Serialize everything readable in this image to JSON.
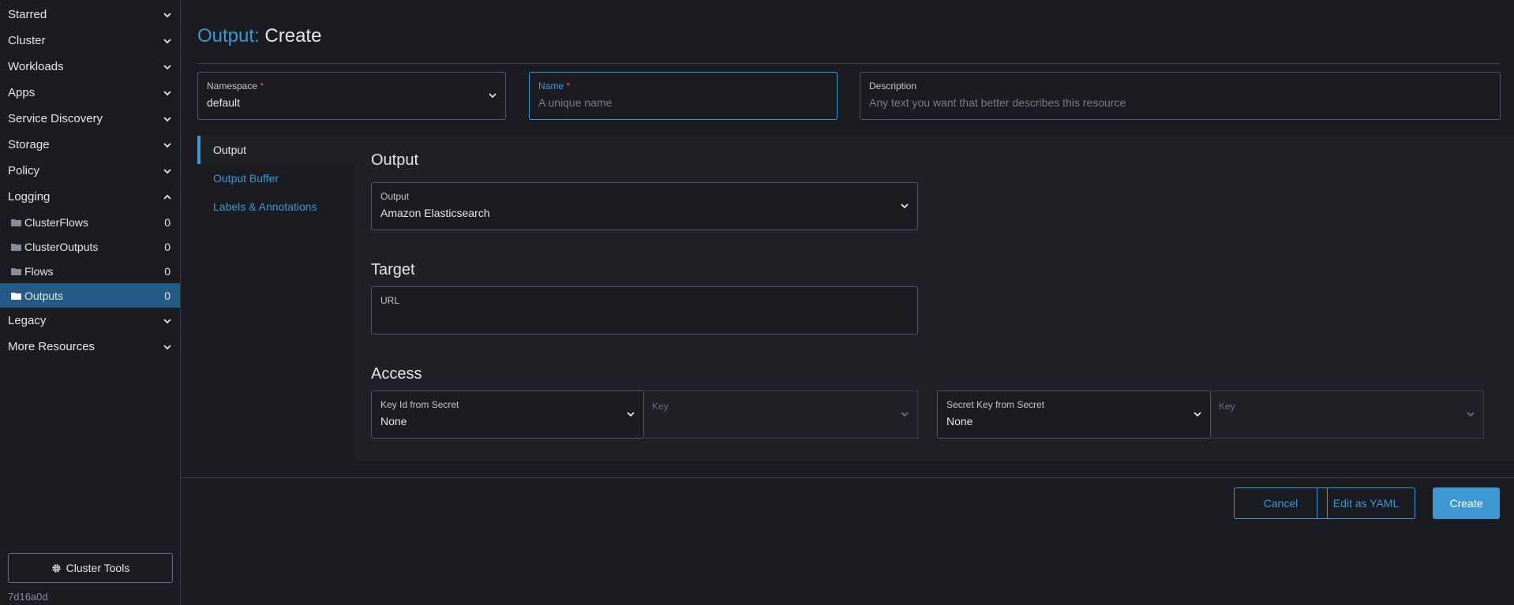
{
  "sidebar": {
    "groups_top": [
      "Starred",
      "Cluster",
      "Workloads",
      "Apps",
      "Service Discovery",
      "Storage",
      "Policy"
    ],
    "logging": {
      "label": "Logging",
      "items": [
        {
          "label": "ClusterFlows",
          "count": "0"
        },
        {
          "label": "ClusterOutputs",
          "count": "0"
        },
        {
          "label": "Flows",
          "count": "0"
        },
        {
          "label": "Outputs",
          "count": "0"
        }
      ]
    },
    "groups_bottom": [
      "Legacy",
      "More Resources"
    ],
    "cluster_tools_label": "Cluster Tools",
    "version": "7d16a0d"
  },
  "header": {
    "title_prefix": "Output:",
    "title_action": "Create"
  },
  "form": {
    "namespace": {
      "label": "Namespace",
      "required_mark": "*",
      "value": "default"
    },
    "name": {
      "label": "Name",
      "required_mark": "*",
      "placeholder": "A unique name"
    },
    "description": {
      "label": "Description",
      "placeholder": "Any text you want that better describes this resource"
    }
  },
  "tabs": [
    "Output",
    "Output Buffer",
    "Labels & Annotations"
  ],
  "output_section": {
    "title": "Output",
    "output_select": {
      "label": "Output",
      "value": "Amazon Elasticsearch"
    }
  },
  "target_section": {
    "title": "Target",
    "url": {
      "label": "URL",
      "value": ""
    }
  },
  "access_section": {
    "title": "Access",
    "key_id": {
      "label": "Key Id from Secret",
      "value": "None",
      "key_label": "Key"
    },
    "secret_key": {
      "label": "Secret Key from Secret",
      "value": "None",
      "key_label": "Key"
    }
  },
  "footer": {
    "cancel": "Cancel",
    "edit_yaml": "Edit as YAML",
    "create": "Create"
  },
  "colors": {
    "accent": "#3d98d3",
    "active_nav": "#235a86",
    "background": "#1b1c21"
  }
}
